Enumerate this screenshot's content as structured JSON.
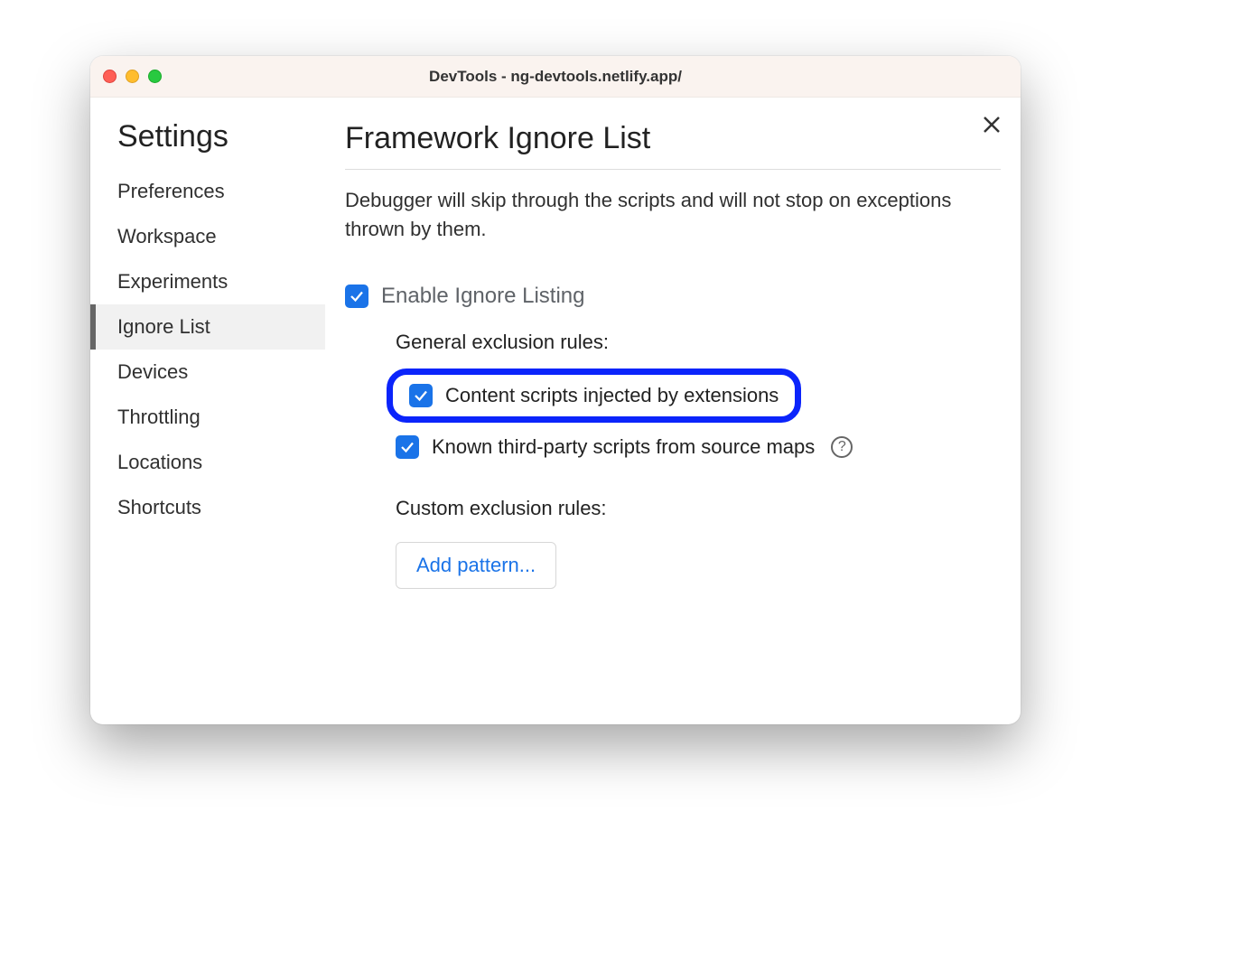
{
  "window": {
    "title": "DevTools - ng-devtools.netlify.app/"
  },
  "sidebar": {
    "title": "Settings",
    "items": [
      {
        "label": "Preferences"
      },
      {
        "label": "Workspace"
      },
      {
        "label": "Experiments"
      },
      {
        "label": "Ignore List"
      },
      {
        "label": "Devices"
      },
      {
        "label": "Throttling"
      },
      {
        "label": "Locations"
      },
      {
        "label": "Shortcuts"
      }
    ],
    "active_index": 3
  },
  "main": {
    "title": "Framework Ignore List",
    "description": "Debugger will skip through the scripts and will not stop on exceptions thrown by them.",
    "enable_label": "Enable Ignore Listing",
    "enable_checked": true,
    "general_rules_label": "General exclusion rules:",
    "rule_content_scripts": {
      "label": "Content scripts injected by extensions",
      "checked": true,
      "highlighted": true
    },
    "rule_third_party": {
      "label": "Known third-party scripts from source maps",
      "checked": true
    },
    "custom_rules_label": "Custom exclusion rules:",
    "add_pattern_label": "Add pattern..."
  }
}
